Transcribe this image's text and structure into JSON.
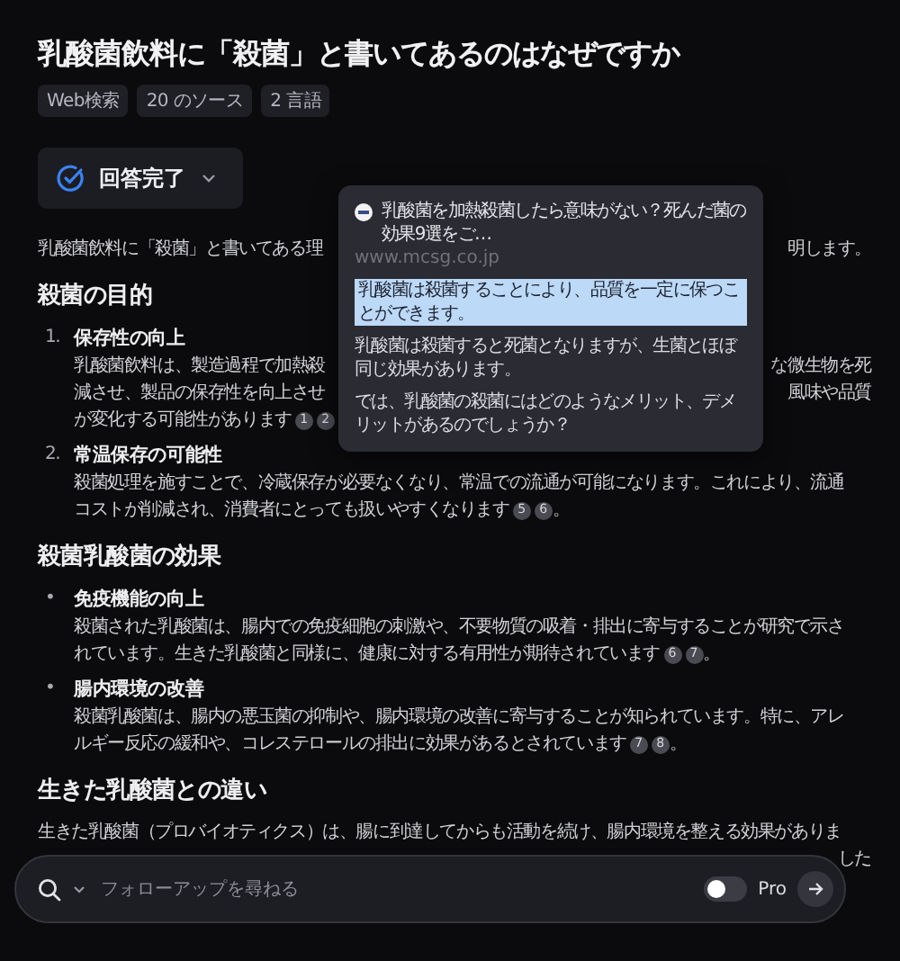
{
  "title": "乳酸菌飲料に「殺菌」と書いてあるのはなぜですか",
  "tags": [
    "Web検索",
    "20 のソース",
    "2 言語"
  ],
  "status_button": {
    "label": "回答完了",
    "expanded": false
  },
  "intro": {
    "left": "乳酸菌飲料に「殺菌」と書いてある理",
    "right": "明します。"
  },
  "sections": [
    {
      "heading": "殺菌の目的",
      "items": [
        {
          "marker": "1.",
          "title": "保存性の向上",
          "lines": [
            {
              "left": "乳酸菌飲料は、製造過程で加熱殺",
              "right": "な微生物を死"
            },
            {
              "left": "減させ、製品の保存性を向上させ",
              "right": "風味や品質"
            },
            {
              "left": "が変化する可能性があります"
            }
          ],
          "citations": [
            "1",
            "2"
          ]
        },
        {
          "marker": "2.",
          "title": "常温保存の可能性",
          "lines": [
            {
              "left": "殺菌処理を施すことで、冷蔵保存が必要なくなり、常温での流通が可能になります。これにより、流通"
            },
            {
              "left": "コストが削減され、消費者にとっても扱いやすくなります"
            }
          ],
          "citations": [
            "5",
            "6"
          ],
          "tail": "。"
        }
      ]
    },
    {
      "heading": "殺菌乳酸菌の効果",
      "items": [
        {
          "marker": "•",
          "title": "免疫機能の向上",
          "lines": [
            {
              "left": "殺菌された乳酸菌は、腸内での免疫細胞の刺激や、不要物質の吸着・排出に寄与することが研究で示さ"
            },
            {
              "left": "れています。生きた乳酸菌と同様に、健康に対する有用性が期待されています"
            }
          ],
          "citations": [
            "6",
            "7"
          ],
          "tail": "。"
        },
        {
          "marker": "•",
          "title": "腸内環境の改善",
          "lines": [
            {
              "left": "殺菌乳酸菌は、腸内の悪玉菌の抑制や、腸内環境の改善に寄与することが知られています。特に、アレ"
            },
            {
              "left": "ルギー反応の緩和や、コレステロールの排出に効果があるとされています"
            }
          ],
          "citations": [
            "7",
            "8"
          ],
          "tail": "。"
        }
      ]
    },
    {
      "heading": "生きた乳酸菌との違い",
      "lines": [
        {
          "left": "生きた乳酸菌（プロバイオティクス）は、腸に到達してからも活動を続け、腸内環境を整える効果がありま"
        },
        {
          "right": "した"
        }
      ]
    }
  ],
  "popover": {
    "title": "乳酸菌を加熱殺菌したら意味がない？死んだ菌の効果9選をご…",
    "url": "www.mcsg.co.jp",
    "highlight": "乳酸菌は殺菌することにより、品質を一定に保つことができます。",
    "paragraphs": [
      "乳酸菌は殺菌すると死菌となりますが、生菌とほぼ同じ効果があります。",
      "では、乳酸菌の殺菌にはどのようなメリット、デメリットがあるのでしょうか？"
    ]
  },
  "search": {
    "placeholder": "フォローアップを尋ねる",
    "pro_label": "Pro",
    "pro_on": false
  }
}
